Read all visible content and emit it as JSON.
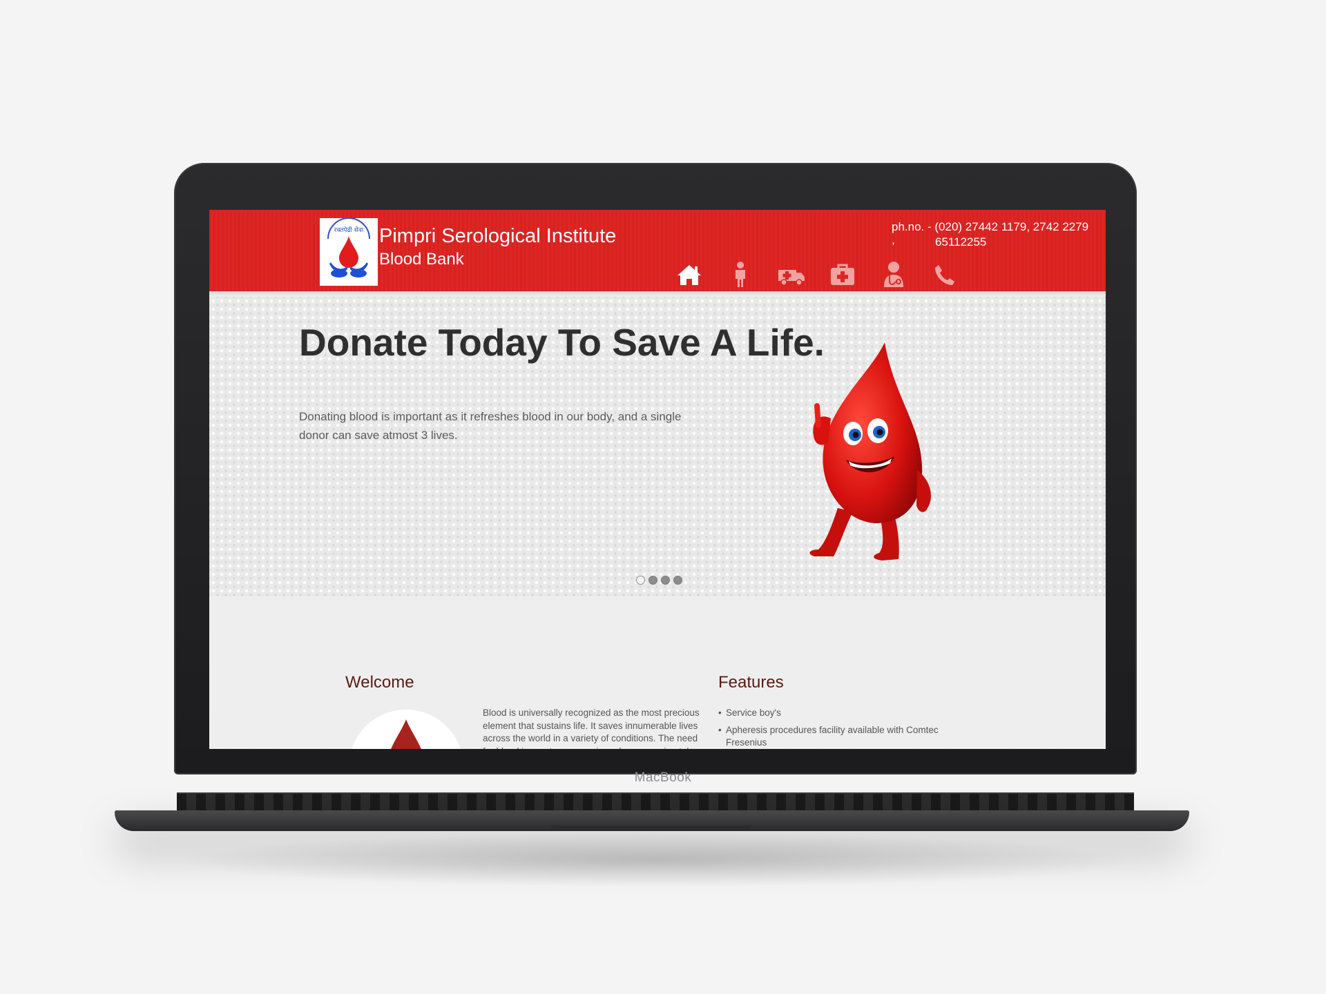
{
  "device": {
    "brand": "MacBook"
  },
  "header": {
    "logo_text": "रक्तपेढी सेवा",
    "title": "Pimpri Serological Institute",
    "subtitle": "Blood Bank",
    "phone_line1": "ph.no. - (020) 27442 1179, 2742 2279",
    "phone_comma": ",",
    "phone_line2": "65112255",
    "nav": [
      {
        "icon": "home-icon"
      },
      {
        "icon": "person-icon"
      },
      {
        "icon": "ambulance-icon"
      },
      {
        "icon": "first-aid-kit-icon"
      },
      {
        "icon": "doctor-icon"
      },
      {
        "icon": "phone-icon"
      }
    ],
    "accent_color": "#dd2725"
  },
  "hero": {
    "title": "Donate Today To Save A Life.",
    "text": "Donating blood is important as it refreshes blood in our body, and a single donor can save atmost 3 lives.",
    "slides": 4,
    "active_slide": 1
  },
  "welcome": {
    "heading": "Welcome",
    "text": "Blood is universally recognized as the most precious element that sustains life. It saves innumerable lives across the world in a variety of conditions. The need for blood is great - on any given day, approximately"
  },
  "features": {
    "heading": "Features",
    "items": [
      "Service boy's",
      "Apheresis procedures facility available with Comtec Fresenius"
    ]
  }
}
